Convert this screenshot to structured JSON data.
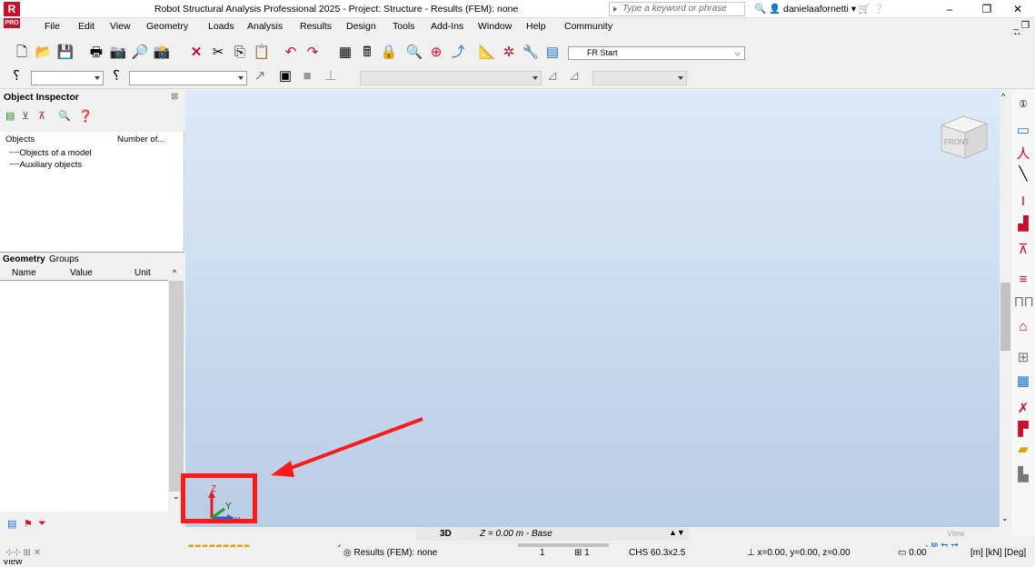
{
  "window": {
    "title": "Robot Structural Analysis Professional 2025 - Project: Structure - Results (FEM): none",
    "logo": "R",
    "edition": "PRO",
    "search_placeholder": "Type a keyword or phrase",
    "user": "danielaafornetti",
    "controls": [
      "–",
      "❐",
      "✕"
    ]
  },
  "menubar": {
    "items": [
      "File",
      "Edit",
      "View",
      "Geometry",
      "Loads",
      "Analysis",
      "Results",
      "Design",
      "Tools",
      "Add-Ins",
      "Window",
      "Help",
      "Community"
    ]
  },
  "toolbar": {
    "start_combo": "FR Start"
  },
  "inspector": {
    "title": "Object Inspector",
    "col_objects": "Objects",
    "col_number": "Number of...",
    "tree": [
      "Objects of a model",
      "Auxiliary objects"
    ],
    "tabs": [
      "Geometry",
      "Groups"
    ],
    "prop_headers": [
      "Name",
      "Value",
      "Unit"
    ]
  },
  "viewport": {
    "cube_label": "FRONT",
    "axis_labels": {
      "z": "Z",
      "y": "Y",
      "x": "X"
    },
    "view_label": "View"
  },
  "bottombar": {
    "mode": "3D",
    "plane": "Z = 0.00 m - Base"
  },
  "statusbar": {
    "view_text": "View",
    "results": "Results (FEM): none",
    "num1": "1",
    "num2": "1",
    "section": "CHS 60.3x2.5",
    "coords": "x=0.00, y=0.00, z=0.00",
    "value": "0.00",
    "units": "[m] [kN] [Deg]"
  },
  "colors": {
    "brand": "#c8102e",
    "annotation": "#ff1a1a",
    "viewport_top": "#dde9f6",
    "viewport_bottom": "#b9cde6"
  }
}
